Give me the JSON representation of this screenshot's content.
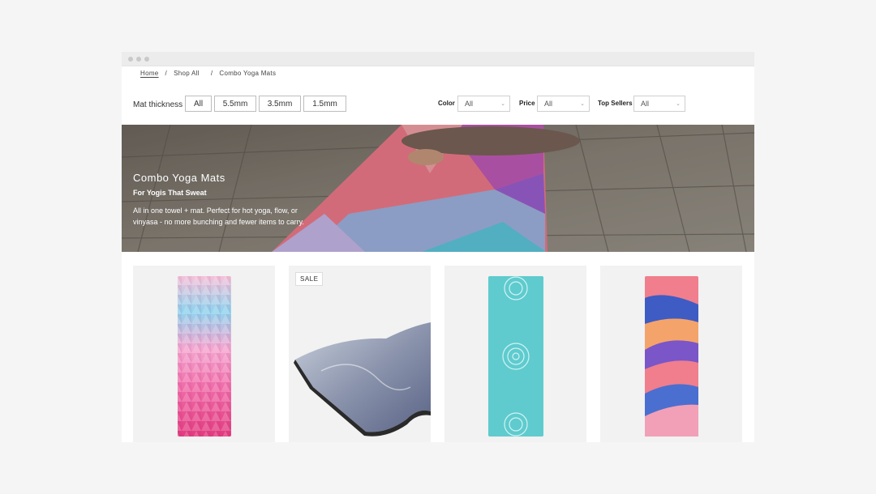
{
  "breadcrumb": {
    "home": "Home",
    "sep1": "/",
    "shop_all": "Shop All",
    "sep2": "/",
    "current": "Combo Yoga Mats"
  },
  "filters": {
    "thickness_label": "Mat thickness",
    "thickness_options": [
      "All",
      "5.5mm",
      "3.5mm",
      "1.5mm"
    ],
    "color_label": "Color",
    "color_value": "All",
    "price_label": "Price",
    "price_value": "All",
    "top_sellers_label": "Top Sellers",
    "top_sellers_value": "All"
  },
  "hero": {
    "title": "Combo Yoga Mats",
    "subtitle": "For Yogis That Sweat",
    "description": "All in one towel + mat.  Perfect for hot yoga, flow, or vinyasa - no more bunching and fewer items to carry."
  },
  "products": [
    {
      "badge": ""
    },
    {
      "badge": "SALE"
    },
    {
      "badge": ""
    },
    {
      "badge": ""
    }
  ],
  "icons": {
    "dropdown": "chevron-down-icon",
    "window_controls": "traffic-light-dots"
  },
  "colors": {
    "background": "#f5f5f5",
    "card_bg": "#f1f2f1",
    "pill_border": "#bdbdbd"
  }
}
